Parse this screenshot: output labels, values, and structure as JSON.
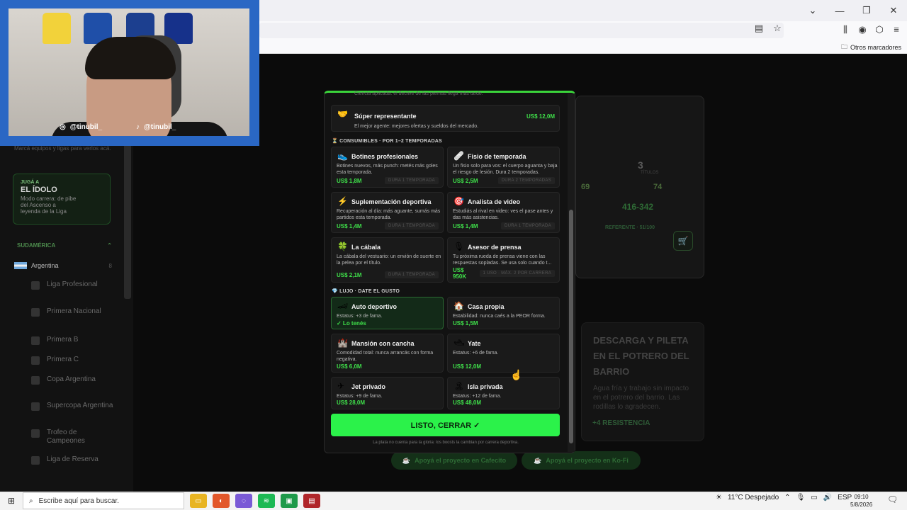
{
  "browser": {
    "other_bookmarks": "Otros marcadores",
    "win_min": "—",
    "win_max": "❐",
    "win_close": "✕",
    "chevron": "⌄"
  },
  "webcam": {
    "instagram": "@tinubil_",
    "tiktok": "@tinubil_"
  },
  "sidebar": {
    "search_hint": "Marcá equipos y ligas para verlos acá.",
    "idol_kicker": "JUGÁ A",
    "idol_title": "EL ÍDOLO",
    "idol_desc": "Modo carrera: de pibe del Ascenso a leyenda de la Liga",
    "region": "SUDAMÉRICA",
    "country": "Argentina",
    "country_count": "8",
    "competitions": [
      "Liga Profesional",
      "Primera Nacional",
      "Primera B",
      "Primera C",
      "Copa Argentina",
      "Supercopa Argentina",
      "Trofeo de Campeones",
      "Liga de Reserva"
    ]
  },
  "dashboard": {
    "titles_value": "3",
    "titles_label": "TÍTULOS",
    "stat_a": "69",
    "stat_b": "74",
    "points": "416-342",
    "referee": "REFERENTE · 51/100"
  },
  "event": {
    "title": "Descarga y pileta en el potrero del barrio",
    "desc": "Agua fría y trabajo sin impacto en el potrero del barrio. Las rodillas lo agradecen.",
    "stat": "+4 RESISTENCIA"
  },
  "support": {
    "cafecito": "Apoyá el proyecto en Cafecito",
    "kofi": "Apoyá el proyecto en Ko-Fi"
  },
  "modal": {
    "cut_text": "Ciencia aplicada: el declive de las piernas llega más tarde.",
    "super_rep": {
      "name": "Súper representante",
      "desc": "El mejor agente: mejores ofertas y sueldos del mercado.",
      "price": "US$ 12,0M"
    },
    "consumables_header": "CONSUMIBLES · POR 1–2 TEMPORADAS",
    "consumables": [
      {
        "name": "Botines profesionales",
        "desc": "Botines nuevos, más punch: metés más goles esta temporada.",
        "price": "US$ 1,8M",
        "badge": "DURA 1 TEMPORADA",
        "icon": "👟"
      },
      {
        "name": "Fisio de temporada",
        "desc": "Un fisio solo para vos: el cuerpo aguanta y baja el riesgo de lesión. Dura 2 temporadas.",
        "price": "US$ 2,5M",
        "badge": "DURA 2 TEMPORADAS",
        "icon": "🩹"
      },
      {
        "name": "Suplementación deportiva",
        "desc": "Recuperación al día: más aguante, sumás más partidos esta temporada.",
        "price": "US$ 1,4M",
        "badge": "DURA 1 TEMPORADA",
        "icon": "⚡"
      },
      {
        "name": "Analista de video",
        "desc": "Estudiás al rival en video: ves el pase antes y das más asistencias.",
        "price": "US$ 1,4M",
        "badge": "DURA 1 TEMPORADA",
        "icon": "🎯"
      },
      {
        "name": "La cábala",
        "desc": "La cábala del vestuario: un envión de suerte en la pelea por el título.",
        "price": "US$ 2,1M",
        "badge": "DURA 1 TEMPORADA",
        "icon": "🍀"
      },
      {
        "name": "Asesor de prensa",
        "desc": "Tu próxima rueda de prensa viene con las respuestas sopladas. Se usa solo cuando t...",
        "price": "US$ 950K",
        "badge": "1 USO · MÁX. 2 POR CARRERA",
        "icon": "🎙"
      }
    ],
    "luxury_header": "LUJO · DATE EL GUSTO",
    "luxury": [
      {
        "name": "Auto deportivo",
        "desc": "Estatus: +3 de fama.",
        "price": "✓ Lo tenés",
        "icon": "🏎"
      },
      {
        "name": "Casa propia",
        "desc": "Estabilidad: nunca caés a la PEOR forma.",
        "price": "US$ 1,5M",
        "icon": "🏠"
      },
      {
        "name": "Mansión con cancha",
        "desc": "Comodidad total: nunca arrancás con forma negativa.",
        "price": "US$ 6,0M",
        "icon": "🏰"
      },
      {
        "name": "Yate",
        "desc": "Estatus: +6 de fama.",
        "price": "US$ 12,0M",
        "icon": "🛥"
      },
      {
        "name": "Jet privado",
        "desc": "Estatus: +9 de fama.",
        "price": "US$ 28,0M",
        "icon": "✈"
      },
      {
        "name": "Isla privada",
        "desc": "Estatus: +12 de fama.",
        "price": "US$ 48,0M",
        "icon": "🏝"
      }
    ],
    "close_label": "LISTO, CERRAR ✓",
    "footnote": "La plata no cuenta para la gloria: los boosts la cambian por carrera deportiva."
  },
  "taskbar": {
    "search_placeholder": "Escribe aquí para buscar.",
    "weather": "11°C  Despejado",
    "lang": "ESP",
    "time": "09:10",
    "date": "5/8/2026"
  },
  "colors": {
    "accent": "#2bf24a",
    "price": "#3fe04a",
    "webcam_frame": "#2a67c4"
  }
}
